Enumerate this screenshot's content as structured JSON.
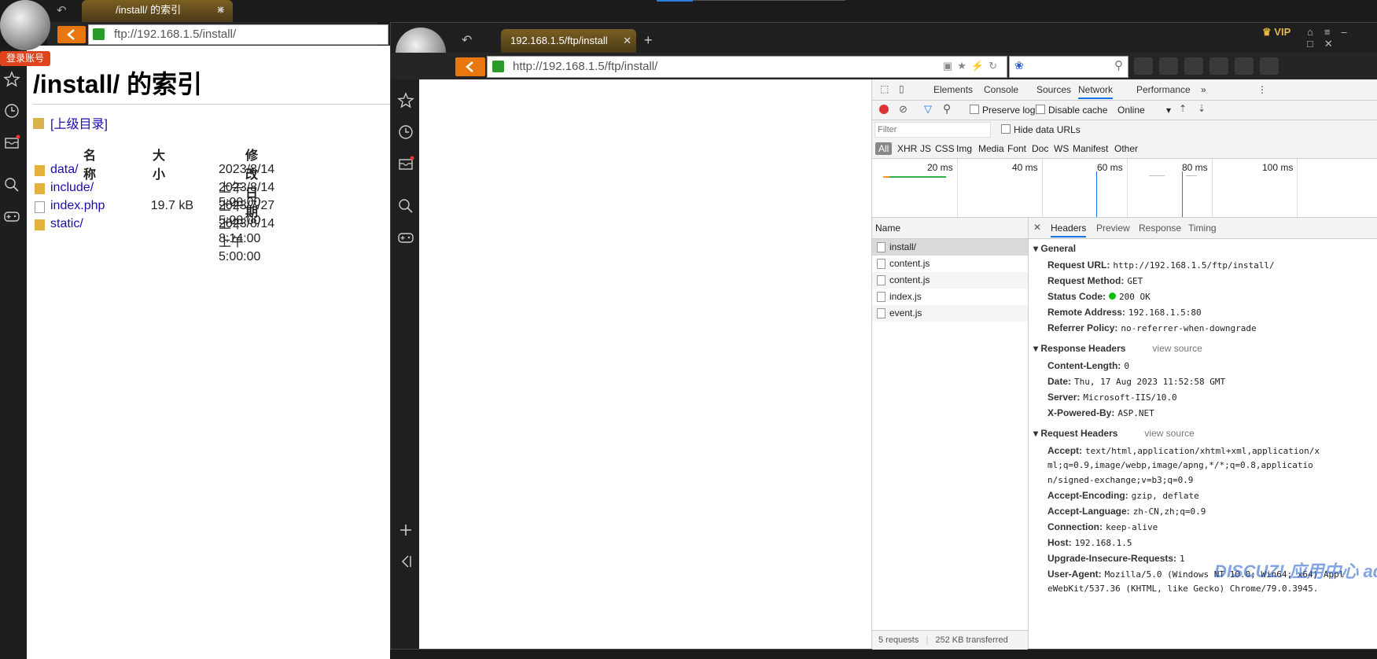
{
  "back_window": {
    "tab_title": "/install/ 的索引",
    "url": "ftp://192.168.1.5/install/",
    "login_badge": "登录账号",
    "heading": "/install/ 的索引",
    "parent_link": "[上级目录]",
    "columns": [
      "名称",
      "大小",
      "修改日期"
    ],
    "entries": [
      {
        "name": "data/",
        "size": "",
        "date": "2023/8/14 上午5:00:00",
        "type": "folder"
      },
      {
        "name": "include/",
        "size": "",
        "date": "2023/8/14 上午5:00:00",
        "type": "folder"
      },
      {
        "name": "index.php",
        "size": "19.7 kB",
        "date": "2023/7/27 上午8:14:00",
        "type": "file"
      },
      {
        "name": "static/",
        "size": "",
        "date": "2023/8/14 上午5:00:00",
        "type": "folder"
      }
    ]
  },
  "front_window": {
    "tab_title": "192.168.1.5/ftp/install",
    "url": "http://192.168.1.5/ftp/install/",
    "vip": "VIP"
  },
  "devtools": {
    "tabs": [
      "Elements",
      "Console",
      "Sources",
      "Network",
      "Performance"
    ],
    "active_tab": "Network",
    "toolbar": {
      "preserve_log": "Preserve log",
      "disable_cache": "Disable cache",
      "throttle": "Online"
    },
    "filter_placeholder": "Filter",
    "hide_data_urls": "Hide data URLs",
    "type_filters": [
      "All",
      "XHR",
      "JS",
      "CSS",
      "Img",
      "Media",
      "Font",
      "Doc",
      "WS",
      "Manifest",
      "Other"
    ],
    "timeline_ticks": [
      "20 ms",
      "40 ms",
      "60 ms",
      "80 ms",
      "100 ms"
    ],
    "name_header": "Name",
    "requests": [
      "install/",
      "content.js",
      "content.js",
      "index.js",
      "event.js"
    ],
    "status_bar": {
      "requests": "5 requests",
      "transferred": "252 KB transferred"
    },
    "detail_tabs": [
      "Headers",
      "Preview",
      "Response",
      "Timing"
    ],
    "general": {
      "title": "General",
      "items": [
        {
          "key": "Request URL:",
          "value": "http://192.168.1.5/ftp/install/"
        },
        {
          "key": "Request Method:",
          "value": "GET"
        },
        {
          "key": "Status Code:",
          "value": "200 OK"
        },
        {
          "key": "Remote Address:",
          "value": "192.168.1.5:80"
        },
        {
          "key": "Referrer Policy:",
          "value": "no-referrer-when-downgrade"
        }
      ]
    },
    "response_headers": {
      "title": "Response Headers",
      "view_source": "view source",
      "items": [
        {
          "key": "Content-Length:",
          "value": "0"
        },
        {
          "key": "Date:",
          "value": "Thu, 17 Aug 2023 11:52:58 GMT"
        },
        {
          "key": "Server:",
          "value": "Microsoft-IIS/10.0"
        },
        {
          "key": "X-Powered-By:",
          "value": "ASP.NET"
        }
      ]
    },
    "request_headers": {
      "title": "Request Headers",
      "view_source": "view source",
      "accept_key": "Accept:",
      "accept_lines": [
        "text/html,application/xhtml+xml,application/x",
        "ml;q=0.9,image/webp,image/apng,*/*;q=0.8,applicatio",
        "n/signed-exchange;v=b3;q=0.9"
      ],
      "items": [
        {
          "key": "Accept-Encoding:",
          "value": "gzip, deflate"
        },
        {
          "key": "Accept-Language:",
          "value": "zh-CN,zh;q=0.9"
        },
        {
          "key": "Connection:",
          "value": "keep-alive"
        },
        {
          "key": "Host:",
          "value": "192.168.1.5"
        },
        {
          "key": "Upgrade-Insecure-Requests:",
          "value": "1"
        }
      ],
      "user_agent_key": "User-Agent:",
      "user_agent_lines": [
        "Mozilla/5.0 (Windows NT 10.0; Win64; x64) Appl",
        "eWebKit/537.36 (KHTML, like Gecko) Chrome/79.0.3945."
      ]
    },
    "watermark": "DISCUZ! 应用中心 addon.dismall.com"
  }
}
